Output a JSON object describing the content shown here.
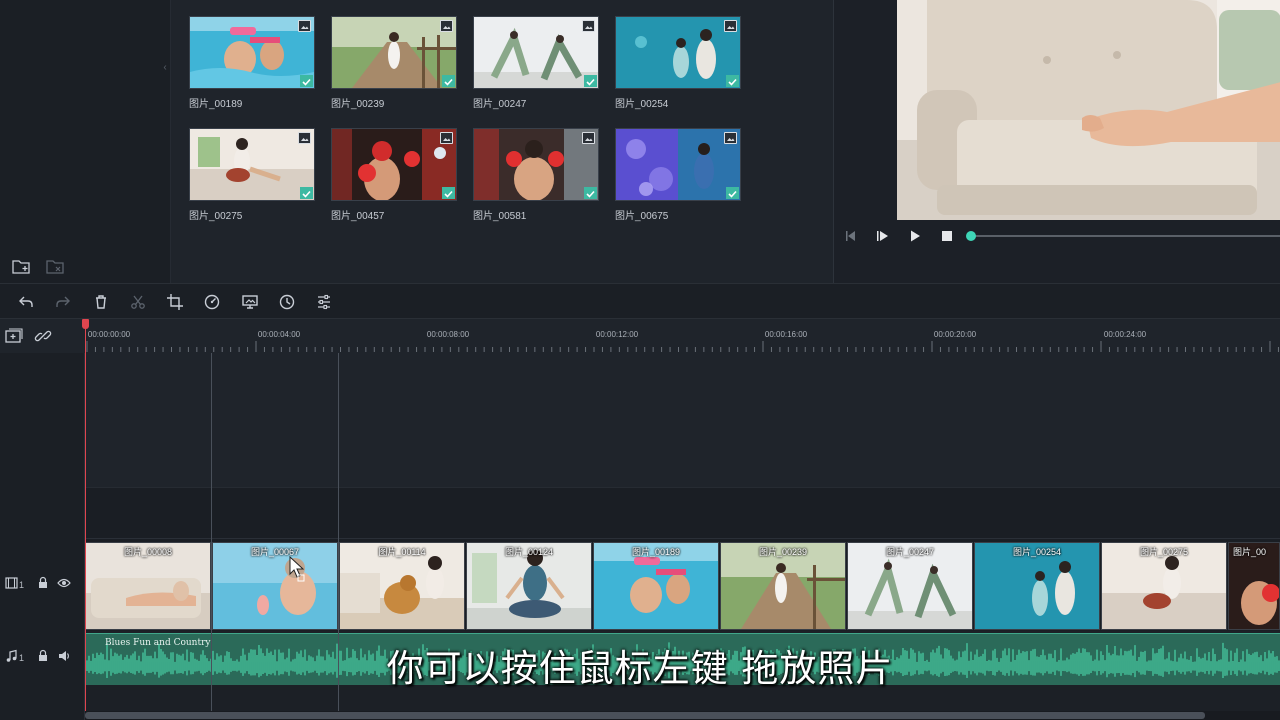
{
  "library": {
    "items": [
      {
        "label": "图片_00189",
        "selected": true
      },
      {
        "label": "图片_00239",
        "selected": true
      },
      {
        "label": "图片_00247",
        "selected": true
      },
      {
        "label": "图片_00254",
        "selected": true
      },
      {
        "label": "图片_00275",
        "selected": true
      },
      {
        "label": "图片_00457",
        "selected": true
      },
      {
        "label": "图片_00581",
        "selected": true
      },
      {
        "label": "图片_00675",
        "selected": true
      }
    ]
  },
  "preview": {
    "progress": 0.0
  },
  "toolbar": {
    "icons": [
      "undo-icon",
      "redo-icon",
      "delete-icon",
      "cut-icon",
      "crop-icon",
      "speed-icon",
      "green-screen-icon",
      "duration-icon",
      "adjust-icon"
    ]
  },
  "timeline": {
    "timecodes": [
      "00:00:00:00",
      "00:00:04:00",
      "00:00:08:00",
      "00:00:12:00",
      "00:00:16:00",
      "00:00:20:00",
      "00:00:24:00"
    ],
    "video_track_number": "1",
    "audio_track_number": "1",
    "clips": [
      {
        "label": "图片_00008"
      },
      {
        "label": "图片_00067"
      },
      {
        "label": "图片_00114"
      },
      {
        "label": "图片_00124"
      },
      {
        "label": "图片_00189"
      },
      {
        "label": "图片_00239"
      },
      {
        "label": "图片_00247"
      },
      {
        "label": "图片_00254"
      },
      {
        "label": "图片_00275"
      },
      {
        "label": "图片_00"
      }
    ],
    "audio_clip_label": "Blues Fun and Country"
  },
  "subtitle": "你可以按住鼠标左键  拖放照片",
  "colors": {
    "accent": "#3ed6b7",
    "playhead": "#e0454f",
    "audio": "#2b6a59"
  }
}
